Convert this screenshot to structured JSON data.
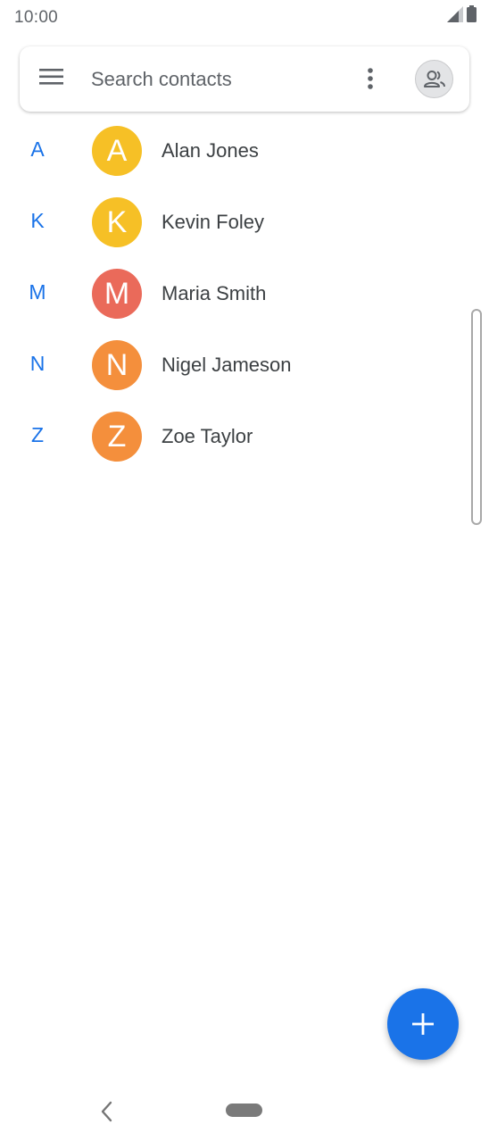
{
  "status_bar": {
    "time": "10:00",
    "icons": [
      "signal-icon",
      "battery-icon"
    ]
  },
  "search": {
    "placeholder": "Search contacts",
    "icons": [
      "menu-icon",
      "more-vert-icon",
      "account-icon"
    ]
  },
  "contacts": [
    {
      "section": "A",
      "initial": "A",
      "name": "Alan Jones",
      "color": "#f6c026"
    },
    {
      "section": "K",
      "initial": "K",
      "name": "Kevin Foley",
      "color": "#f6c026"
    },
    {
      "section": "M",
      "initial": "M",
      "name": "Maria Smith",
      "color": "#ea6a5a"
    },
    {
      "section": "N",
      "initial": "N",
      "name": "Nigel Jameson",
      "color": "#f48f3c"
    },
    {
      "section": "Z",
      "initial": "Z",
      "name": "Zoe Taylor",
      "color": "#f48f3c"
    }
  ],
  "fab": {
    "icon": "add-icon",
    "color": "#1a73e8"
  },
  "nav": {
    "icons": [
      "back-icon",
      "home-pill-icon"
    ]
  },
  "colors": {
    "accent": "#1a73e8",
    "text": "#3c4043",
    "secondary_text": "#5f6368"
  }
}
